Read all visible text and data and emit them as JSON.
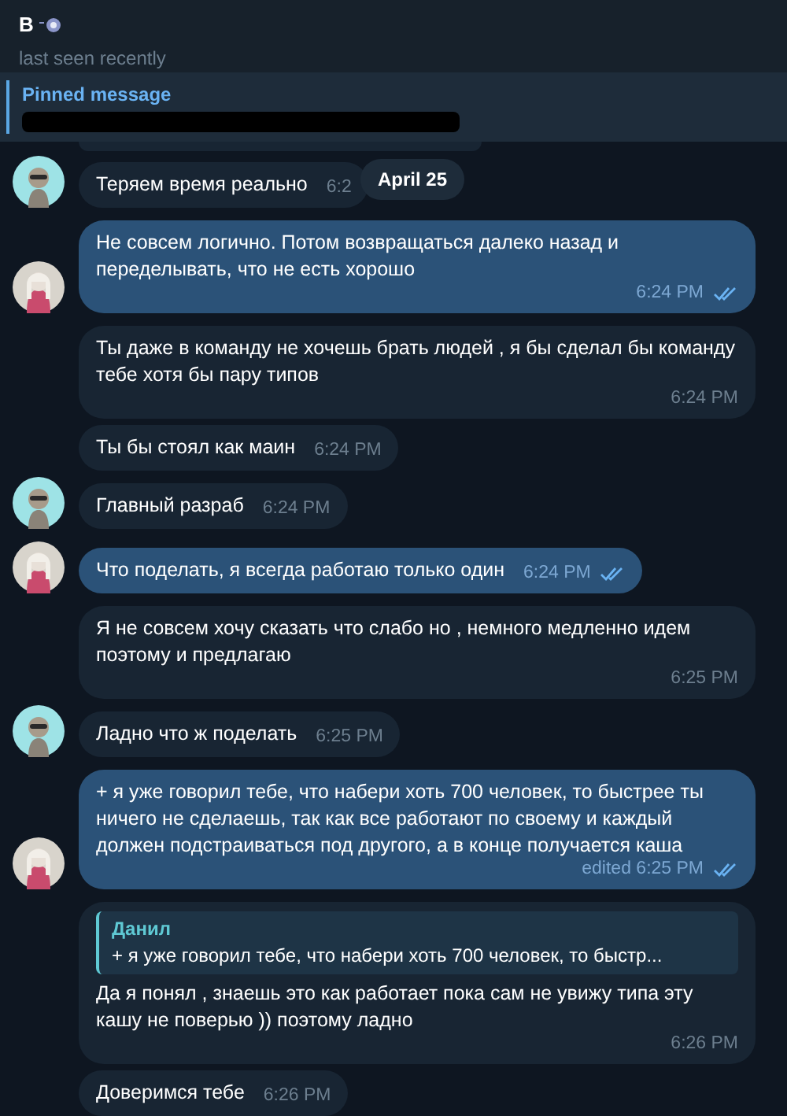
{
  "header": {
    "title": "B",
    "status": "last seen recently"
  },
  "pinned": {
    "label": "Pinned message"
  },
  "date_badge": "April 25",
  "messages": [
    {
      "kind": "incoming",
      "text": "Теряем время реально",
      "time": "6:2",
      "avatar": true
    },
    {
      "kind": "outgoing",
      "text": "Не совсем логично. Потом возвращаться далеко назад и переделывать, что не есть хорошо",
      "time": "6:24 PM",
      "read": true,
      "avatar": true
    },
    {
      "kind": "incoming",
      "text": "Ты даже в команду не хочешь брать людей , я бы сделал бы команду тебе хотя бы пару типов",
      "time": "6:24 PM",
      "avatar": false
    },
    {
      "kind": "incoming",
      "text": "Ты бы стоял как маин",
      "time": "6:24 PM",
      "avatar": false
    },
    {
      "kind": "incoming",
      "text": "Главный разраб",
      "time": "6:24 PM",
      "avatar": true
    },
    {
      "kind": "outgoing",
      "text": "Что поделать, я всегда работаю только один",
      "time": "6:24 PM",
      "read": true,
      "avatar": true
    },
    {
      "kind": "incoming",
      "text": "Я не совсем хочу сказать что слабо но , немного медленно идем поэтому и предлагаю",
      "time": "6:25 PM",
      "avatar": false
    },
    {
      "kind": "incoming",
      "text": "Ладно что ж поделать",
      "time": "6:25 PM",
      "avatar": true
    },
    {
      "kind": "outgoing",
      "text": "+ я уже говорил тебе, что набери хоть 700 человек, то быстрее ты ничего не сделаешь, так как все работают по своему и каждый должен подстраиваться под другого, а в конце получается каша",
      "time": "edited 6:25 PM",
      "read": true,
      "avatar": true
    },
    {
      "kind": "incoming",
      "reply": {
        "name": "Данил",
        "text": "+ я уже говорил тебе, что набери хоть 700 человек, то быстр..."
      },
      "text": "Да я понял , знаешь это как работает пока сам не увижу типа эту кашу не поверью )) поэтому ладно",
      "time": "6:26 PM",
      "avatar": false
    },
    {
      "kind": "incoming",
      "text": "Доверимся тебе",
      "time": "6:26 PM",
      "avatar": false
    }
  ]
}
